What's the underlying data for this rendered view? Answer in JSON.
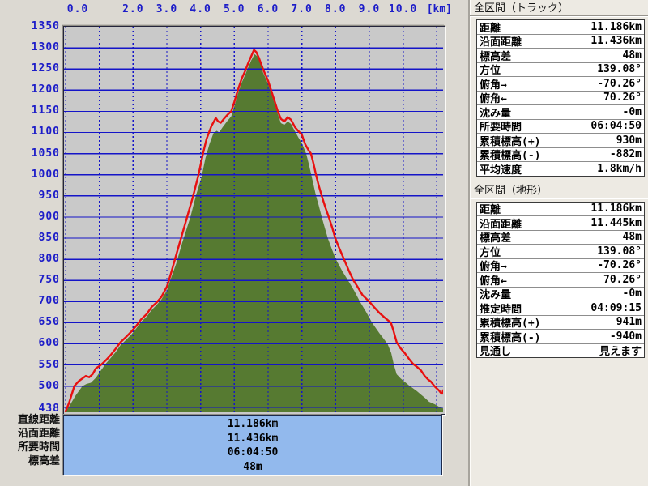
{
  "window": {
    "app_context": "elevation-profile-graph-window"
  },
  "axis": {
    "unit_label": "[km]",
    "x_ticks": [
      {
        "km": 0,
        "label": "0.0"
      },
      {
        "km": 2,
        "label": "2.0"
      },
      {
        "km": 3,
        "label": "3.0"
      },
      {
        "km": 4,
        "label": "4.0"
      },
      {
        "km": 5,
        "label": "5.0"
      },
      {
        "km": 6,
        "label": "6.0"
      },
      {
        "km": 7,
        "label": "7.0"
      },
      {
        "km": 8,
        "label": "8.0"
      },
      {
        "km": 9,
        "label": "9.0"
      },
      {
        "km": 10,
        "label": "10.0"
      }
    ],
    "y_ticks": [
      1350,
      1300,
      1250,
      1200,
      1150,
      1100,
      1050,
      1000,
      950,
      900,
      850,
      800,
      750,
      700,
      650,
      600,
      550,
      500
    ],
    "y_min_label": "438"
  },
  "chart_data": {
    "type": "area",
    "title": "",
    "xlabel": "[km]",
    "ylabel": "",
    "xlim": [
      0,
      11.186
    ],
    "ylim": [
      438,
      1350
    ],
    "x_grid_step_km": 1,
    "y_grid_step_m": 50,
    "grid": true,
    "colors": {
      "plot_bg": "#c9c9c9",
      "grid": "#1414c8",
      "terrain_fill": "#567a31",
      "track_line": "#e81010",
      "axis_text": "#1c1cc8",
      "info_panel_bg": "#92b9ed"
    },
    "series": [
      {
        "name": "terrain-elevation",
        "style": "area",
        "color": "#567a31",
        "points": [
          [
            0.0,
            438
          ],
          [
            0.15,
            458
          ],
          [
            0.3,
            478
          ],
          [
            0.5,
            500
          ],
          [
            0.62,
            505
          ],
          [
            0.75,
            508
          ],
          [
            0.9,
            520
          ],
          [
            1.03,
            535
          ],
          [
            1.18,
            552
          ],
          [
            1.32,
            565
          ],
          [
            1.48,
            580
          ],
          [
            1.63,
            597
          ],
          [
            1.8,
            610
          ],
          [
            1.95,
            622
          ],
          [
            2.1,
            637
          ],
          [
            2.24,
            652
          ],
          [
            2.4,
            664
          ],
          [
            2.55,
            680
          ],
          [
            2.7,
            692
          ],
          [
            2.84,
            705
          ],
          [
            3.0,
            726
          ],
          [
            3.1,
            750
          ],
          [
            3.28,
            790
          ],
          [
            3.46,
            840
          ],
          [
            3.7,
            900
          ],
          [
            3.86,
            950
          ],
          [
            4.03,
            995
          ],
          [
            4.14,
            1038
          ],
          [
            4.26,
            1072
          ],
          [
            4.38,
            1098
          ],
          [
            4.48,
            1104
          ],
          [
            4.55,
            1100
          ],
          [
            4.65,
            1112
          ],
          [
            4.8,
            1128
          ],
          [
            4.91,
            1138
          ],
          [
            5.0,
            1162
          ],
          [
            5.1,
            1190
          ],
          [
            5.22,
            1218
          ],
          [
            5.32,
            1236
          ],
          [
            5.4,
            1252
          ],
          [
            5.5,
            1270
          ],
          [
            5.6,
            1285
          ],
          [
            5.68,
            1280
          ],
          [
            5.75,
            1268
          ],
          [
            5.85,
            1242
          ],
          [
            6.0,
            1215
          ],
          [
            6.15,
            1178
          ],
          [
            6.29,
            1143
          ],
          [
            6.38,
            1122
          ],
          [
            6.48,
            1118
          ],
          [
            6.58,
            1126
          ],
          [
            6.68,
            1120
          ],
          [
            6.8,
            1102
          ],
          [
            6.9,
            1088
          ],
          [
            7.0,
            1075
          ],
          [
            7.13,
            1050
          ],
          [
            7.2,
            1028
          ],
          [
            7.28,
            1000
          ],
          [
            7.35,
            975
          ],
          [
            7.42,
            950
          ],
          [
            7.5,
            928
          ],
          [
            7.59,
            900
          ],
          [
            7.68,
            875
          ],
          [
            7.77,
            850
          ],
          [
            7.9,
            822
          ],
          [
            8.01,
            800
          ],
          [
            8.2,
            772
          ],
          [
            8.37,
            750
          ],
          [
            8.55,
            726
          ],
          [
            8.72,
            700
          ],
          [
            8.9,
            676
          ],
          [
            9.08,
            650
          ],
          [
            9.3,
            625
          ],
          [
            9.54,
            600
          ],
          [
            9.65,
            578
          ],
          [
            9.73,
            550
          ],
          [
            9.81,
            528
          ],
          [
            9.93,
            518
          ],
          [
            10.05,
            510
          ],
          [
            10.17,
            502
          ],
          [
            10.29,
            495
          ],
          [
            10.41,
            488
          ],
          [
            10.53,
            480
          ],
          [
            10.65,
            472
          ],
          [
            10.77,
            463
          ],
          [
            10.94,
            457
          ],
          [
            11.05,
            452
          ],
          [
            11.15,
            448
          ],
          [
            11.186,
            447
          ]
        ]
      },
      {
        "name": "track-elevation",
        "style": "line",
        "color": "#e81010",
        "points": [
          [
            0.0,
            440
          ],
          [
            0.1,
            460
          ],
          [
            0.18,
            480
          ],
          [
            0.26,
            500
          ],
          [
            0.38,
            511
          ],
          [
            0.5,
            518
          ],
          [
            0.6,
            524
          ],
          [
            0.7,
            521
          ],
          [
            0.8,
            528
          ],
          [
            0.9,
            542
          ],
          [
            1.03,
            549
          ],
          [
            1.18,
            560
          ],
          [
            1.32,
            572
          ],
          [
            1.48,
            588
          ],
          [
            1.63,
            604
          ],
          [
            1.8,
            617
          ],
          [
            1.95,
            629
          ],
          [
            2.1,
            643
          ],
          [
            2.24,
            658
          ],
          [
            2.4,
            670
          ],
          [
            2.55,
            687
          ],
          [
            2.7,
            698
          ],
          [
            2.84,
            711
          ],
          [
            3.0,
            735
          ],
          [
            3.1,
            760
          ],
          [
            3.24,
            800
          ],
          [
            3.42,
            850
          ],
          [
            3.6,
            900
          ],
          [
            3.78,
            950
          ],
          [
            3.94,
            1000
          ],
          [
            4.07,
            1050
          ],
          [
            4.18,
            1085
          ],
          [
            4.32,
            1115
          ],
          [
            4.45,
            1134
          ],
          [
            4.52,
            1126
          ],
          [
            4.6,
            1123
          ],
          [
            4.7,
            1133
          ],
          [
            4.8,
            1142
          ],
          [
            4.91,
            1150
          ],
          [
            5.0,
            1172
          ],
          [
            5.1,
            1199
          ],
          [
            5.22,
            1228
          ],
          [
            5.32,
            1245
          ],
          [
            5.4,
            1262
          ],
          [
            5.5,
            1280
          ],
          [
            5.58,
            1295
          ],
          [
            5.65,
            1290
          ],
          [
            5.72,
            1278
          ],
          [
            5.85,
            1250
          ],
          [
            6.0,
            1222
          ],
          [
            6.15,
            1185
          ],
          [
            6.29,
            1150
          ],
          [
            6.38,
            1132
          ],
          [
            6.48,
            1126
          ],
          [
            6.58,
            1136
          ],
          [
            6.68,
            1130
          ],
          [
            6.8,
            1112
          ],
          [
            6.9,
            1103
          ],
          [
            7.0,
            1095
          ],
          [
            7.1,
            1072
          ],
          [
            7.2,
            1058
          ],
          [
            7.27,
            1050
          ],
          [
            7.35,
            1025
          ],
          [
            7.42,
            1000
          ],
          [
            7.5,
            975
          ],
          [
            7.59,
            950
          ],
          [
            7.7,
            922
          ],
          [
            7.8,
            900
          ],
          [
            7.9,
            875
          ],
          [
            7.99,
            850
          ],
          [
            8.1,
            828
          ],
          [
            8.25,
            800
          ],
          [
            8.4,
            772
          ],
          [
            8.53,
            750
          ],
          [
            8.65,
            735
          ],
          [
            8.8,
            715
          ],
          [
            9.0,
            700
          ],
          [
            9.15,
            686
          ],
          [
            9.3,
            673
          ],
          [
            9.47,
            661
          ],
          [
            9.64,
            650
          ],
          [
            9.72,
            630
          ],
          [
            9.81,
            604
          ],
          [
            9.92,
            590
          ],
          [
            10.05,
            578
          ],
          [
            10.17,
            565
          ],
          [
            10.29,
            553
          ],
          [
            10.42,
            545
          ],
          [
            10.53,
            537
          ],
          [
            10.64,
            524
          ],
          [
            10.75,
            515
          ],
          [
            10.82,
            511
          ],
          [
            10.94,
            499
          ],
          [
            11.06,
            490
          ],
          [
            11.12,
            484
          ],
          [
            11.16,
            482
          ],
          [
            11.186,
            490
          ]
        ]
      }
    ]
  },
  "summary_footer": {
    "rows": [
      {
        "label": "直線距離",
        "value": "11.186km"
      },
      {
        "label": "沿面距離",
        "value": "11.436km"
      },
      {
        "label": "所要時間",
        "value": "06:04:50"
      },
      {
        "label": "標高差",
        "value": "48m"
      }
    ]
  },
  "panels": [
    {
      "title": "全区間（トラック）",
      "rows": [
        {
          "label": "距離",
          "value": "11.186km"
        },
        {
          "label": "沿面距離",
          "value": "11.436km"
        },
        {
          "label": "標高差",
          "value": "48m"
        },
        {
          "label": "方位",
          "value": "139.08°"
        },
        {
          "label": "俯角→",
          "value": "-70.26°"
        },
        {
          "label": "俯角←",
          "value": "70.26°"
        },
        {
          "label": "沈み量",
          "value": "-0m"
        },
        {
          "label": "所要時間",
          "value": "06:04:50"
        },
        {
          "label": "累積標高(+)",
          "value": "930m"
        },
        {
          "label": "累積標高(-)",
          "value": "-882m"
        },
        {
          "label": "平均速度",
          "value": "1.8km/h"
        }
      ]
    },
    {
      "title": "全区間（地形）",
      "rows": [
        {
          "label": "距離",
          "value": "11.186km"
        },
        {
          "label": "沿面距離",
          "value": "11.445km"
        },
        {
          "label": "標高差",
          "value": "48m"
        },
        {
          "label": "方位",
          "value": "139.08°"
        },
        {
          "label": "俯角→",
          "value": "-70.26°"
        },
        {
          "label": "俯角←",
          "value": "70.26°"
        },
        {
          "label": "沈み量",
          "value": "-0m"
        },
        {
          "label": "推定時間",
          "value": "04:09:15"
        },
        {
          "label": "累積標高(+)",
          "value": "941m"
        },
        {
          "label": "累積標高(-)",
          "value": "-940m"
        },
        {
          "label": "見通し",
          "value": "見えます"
        }
      ]
    }
  ]
}
